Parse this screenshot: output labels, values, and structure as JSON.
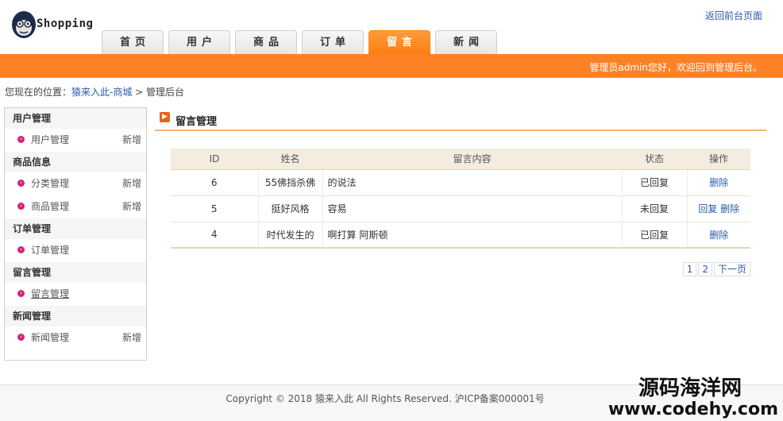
{
  "header": {
    "logo_text": "Shopping",
    "back_link": "返回前台页面",
    "nav": [
      "首页",
      "用户",
      "商品",
      "订单",
      "留言",
      "新闻"
    ],
    "active_nav_index": 4,
    "welcome": "管理员admin您好，欢迎回到管理后台。"
  },
  "breadcrumb": {
    "prefix": "您现在的位置：",
    "site": "猿来入此-商城",
    "separator": " > ",
    "current": "管理后台"
  },
  "sidebar": {
    "groups": [
      {
        "title": "用户管理",
        "items": [
          {
            "label": "用户管理",
            "add": "新增"
          }
        ]
      },
      {
        "title": "商品信息",
        "items": [
          {
            "label": "分类管理",
            "add": "新增"
          },
          {
            "label": "商品管理",
            "add": "新增"
          }
        ]
      },
      {
        "title": "订单管理",
        "items": [
          {
            "label": "订单管理",
            "add": ""
          }
        ]
      },
      {
        "title": "留言管理",
        "items": [
          {
            "label": "留言管理",
            "add": ""
          }
        ]
      },
      {
        "title": "新闻管理",
        "items": [
          {
            "label": "新闻管理",
            "add": "新增"
          }
        ]
      }
    ]
  },
  "panel": {
    "title": "留言管理",
    "columns": [
      "ID",
      "姓名",
      "留言内容",
      "状态",
      "操作"
    ],
    "rows": [
      {
        "id": "6",
        "name": "55佛挡杀佛",
        "content": "的说法",
        "status": "已回复",
        "reply": "",
        "delete": "删除"
      },
      {
        "id": "5",
        "name": "挺好风格",
        "content": "容易",
        "status": "未回复",
        "reply": "回复",
        "delete": "删除"
      },
      {
        "id": "4",
        "name": "时代发生的",
        "content": "啊打算 阿斯顿",
        "status": "已回复",
        "reply": "",
        "delete": "删除"
      }
    ],
    "pager": [
      "1",
      "2",
      "下一页"
    ]
  },
  "footer": {
    "copyright": "Copyright © 2018 猿来入此 All Rights Reserved. 沪ICP备案000001号"
  },
  "watermark": {
    "line1": "源码海洋网",
    "line2": "www.codehy.com"
  },
  "colors": {
    "accent": "#ff8126",
    "link": "#2a5bab",
    "bullet": "#d4237a"
  }
}
